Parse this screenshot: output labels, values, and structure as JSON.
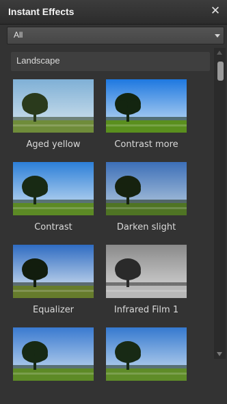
{
  "panel": {
    "title": "Instant Effects",
    "close_icon": "close-icon",
    "filter": {
      "selected": "All",
      "icon": "chevron-down-icon"
    },
    "category": "Landscape"
  },
  "effects": [
    {
      "label": "Aged yellow",
      "sky_top": "#7fb0d6",
      "sky_bottom": "#d8e6ef",
      "ground": "#6f8c3a",
      "tree": "#2a3a1c"
    },
    {
      "label": "Contrast more",
      "sky_top": "#1e78e0",
      "sky_bottom": "#cfe3f5",
      "ground": "#5a8f1e",
      "tree": "#132510"
    },
    {
      "label": "Contrast",
      "sky_top": "#2c7fd8",
      "sky_bottom": "#d4e5f4",
      "ground": "#5c8a25",
      "tree": "#182a14"
    },
    {
      "label": "Darken slight",
      "sky_top": "#3c6fb8",
      "sky_bottom": "#bccfe0",
      "ground": "#4f7424",
      "tree": "#16220f"
    },
    {
      "label": "Equalizer",
      "sky_top": "#2f6cc2",
      "sky_bottom": "#e3edf6",
      "ground": "#667c2c",
      "tree": "#121d0e"
    },
    {
      "label": "Infrared Film 1",
      "sky_top": "#8a8a8a",
      "sky_bottom": "#dcdcdc",
      "ground": "#b8b8b8",
      "tree": "#2a2a2a"
    },
    {
      "label": "",
      "sky_top": "#3a7ad0",
      "sky_bottom": "#cfe1f2",
      "ground": "#5d8a26",
      "tree": "#172914"
    },
    {
      "label": "",
      "sky_top": "#3579cf",
      "sky_bottom": "#d0e2f3",
      "ground": "#5f8c28",
      "tree": "#182a15"
    }
  ],
  "scrollbar": {
    "position": 0.0
  }
}
